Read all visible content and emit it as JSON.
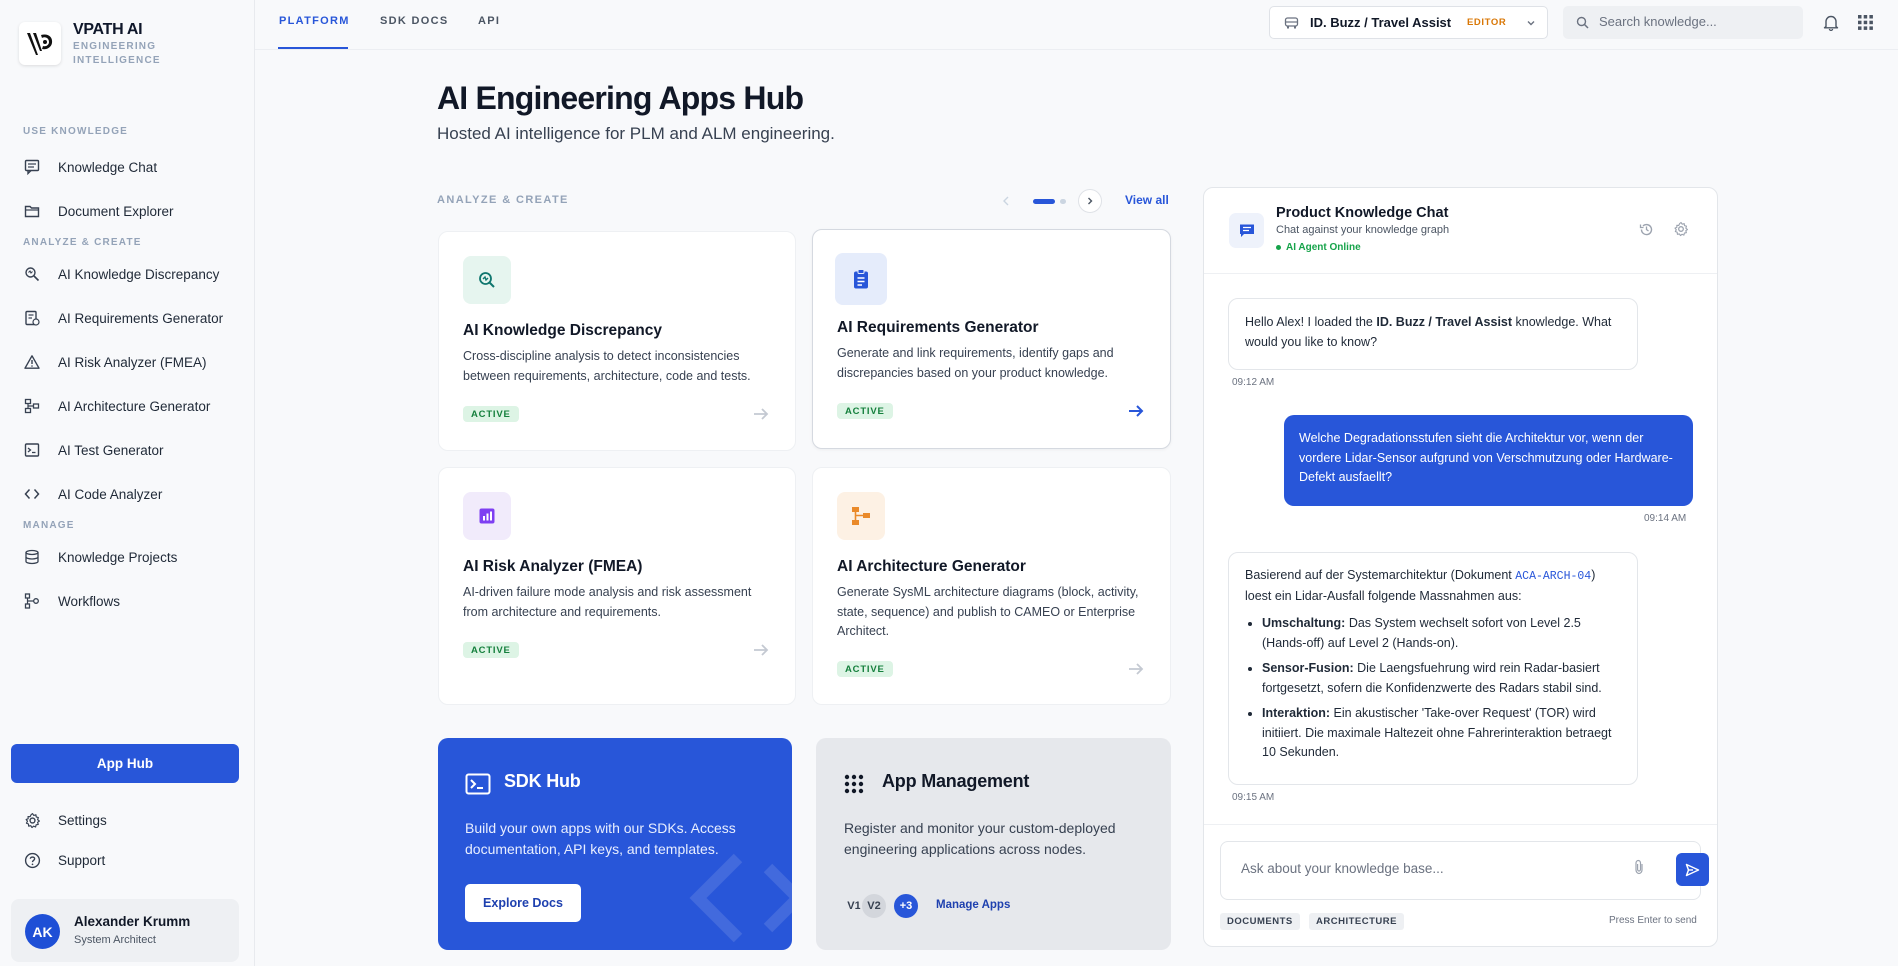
{
  "brand": {
    "title": "VPATH AI",
    "subtitle": "ENGINEERING INTELLIGENCE"
  },
  "sidebar": {
    "sections": {
      "use": "USE KNOWLEDGE",
      "analyze": "ANALYZE & CREATE",
      "manage": "MANAGE"
    },
    "items": [
      {
        "label": "Knowledge Chat",
        "icon": "chat-icon"
      },
      {
        "label": "Document Explorer",
        "icon": "folder-icon"
      },
      {
        "label": "AI Knowledge Discrepancy",
        "icon": "search-sparkle-icon"
      },
      {
        "label": "AI Requirements Generator",
        "icon": "checklist-icon"
      },
      {
        "label": "AI Risk Analyzer (FMEA)",
        "icon": "warning-icon"
      },
      {
        "label": "AI Architecture Generator",
        "icon": "architecture-icon"
      },
      {
        "label": "AI Test Generator",
        "icon": "terminal-icon"
      },
      {
        "label": "AI Code Analyzer",
        "icon": "code-icon"
      },
      {
        "label": "Knowledge Projects",
        "icon": "database-icon"
      },
      {
        "label": "Workflows",
        "icon": "workflow-icon"
      }
    ],
    "app_hub": "App Hub",
    "settings": "Settings",
    "support": "Support",
    "user": {
      "initials": "AK",
      "name": "Alexander Krumm",
      "role": "System Architect"
    }
  },
  "topbar": {
    "tabs": [
      "PLATFORM",
      "SDK DOCS",
      "API"
    ],
    "project": "ID. Buzz / Travel Assist",
    "role_badge": "EDITOR",
    "search_placeholder": "Search knowledge..."
  },
  "main": {
    "title": "AI Engineering Apps Hub",
    "subtitle": "Hosted AI intelligence for PLM and ALM engineering.",
    "section": "ANALYZE & CREATE",
    "view_all": "View all",
    "cards": [
      {
        "title": "AI Knowledge Discrepancy",
        "desc": "Cross-discipline analysis to detect inconsistencies between requirements, architecture, code and tests.",
        "status": "ACTIVE",
        "icon": "search-sparkle-icon"
      },
      {
        "title": "AI Requirements Generator",
        "desc": "Generate and link requirements, identify gaps and discrepancies based on your product knowledge.",
        "status": "ACTIVE",
        "icon": "clipboard-icon"
      },
      {
        "title": "AI Risk Analyzer (FMEA)",
        "desc": "AI-driven failure mode analysis and risk assessment from architecture and requirements.",
        "status": "ACTIVE",
        "icon": "chart-icon"
      },
      {
        "title": "AI Architecture Generator",
        "desc": "Generate SysML architecture diagrams (block, activity, state, sequence) and publish to CAMEO or Enterprise Architect.",
        "status": "ACTIVE",
        "icon": "architecture-icon"
      }
    ],
    "sdk": {
      "title": "SDK Hub",
      "desc": "Build your own apps with our SDKs. Access documentation, API keys, and templates.",
      "button": "Explore Docs"
    },
    "mgmt": {
      "title": "App Management",
      "desc": "Register and monitor your custom-deployed engineering applications across nodes.",
      "versions": [
        "V1",
        "V2",
        "+3"
      ],
      "link": "Manage Apps"
    }
  },
  "chat": {
    "title": "Product Knowledge Chat",
    "subtitle": "Chat against your knowledge graph",
    "status": "AI Agent Online",
    "messages": {
      "m1_pre": "Hello Alex! I loaded the ",
      "m1_bold": "ID. Buzz / Travel Assist",
      "m1_post": " knowledge. What would you like to know?",
      "m1_time": "09:12 AM",
      "m2": "Welche Degradationsstufen sieht die Architektur vor, wenn der vordere Lidar-Sensor aufgrund von Verschmutzung oder Hardware-Defekt ausfaellt?",
      "m2_time": "09:14 AM",
      "m3_pre": "Basierend auf der Systemarchitektur (Dokument ",
      "m3_code": "ACA-ARCH-04",
      "m3_post": ") loest ein Lidar-Ausfall folgende Massnahmen aus:",
      "m3_items": [
        {
          "bold": "Umschaltung:",
          "text": " Das System wechselt sofort von Level 2.5 (Hands-off) auf Level 2 (Hands-on)."
        },
        {
          "bold": "Sensor-Fusion:",
          "text": " Die Laengsfuehrung wird rein Radar-basiert fortgesetzt, sofern die Konfidenzwerte des Radars stabil sind."
        },
        {
          "bold": "Interaktion:",
          "text": " Ein akustischer 'Take-over Request' (TOR) wird initiiert. Die maximale Haltezeit ohne Fahrerinteraktion betraegt 10 Sekunden."
        }
      ],
      "m3_time": "09:15 AM"
    },
    "input_placeholder": "Ask about your knowledge base...",
    "chips": [
      "DOCUMENTS",
      "ARCHITECTURE"
    ],
    "hint": "Press Enter to send"
  }
}
